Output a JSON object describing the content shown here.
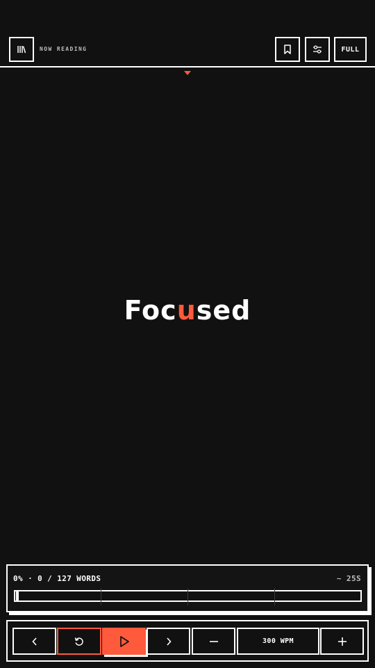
{
  "header": {
    "library_icon": "library-icon",
    "label": "NOW READING",
    "bookmark_icon": "bookmark-icon",
    "settings_icon": "sliders-icon",
    "full_label": "FULL"
  },
  "reader": {
    "word_pre": "Foc",
    "word_focus": "u",
    "word_post": "sed",
    "focus_color": "#ff5a3c"
  },
  "progress": {
    "status": "0% · 0 / 127 WORDS",
    "time_left": "~ 25S",
    "fraction": 0,
    "accent": "#ff5a3c"
  },
  "controls": {
    "prev_icon": "chevron-left-icon",
    "rewind_icon": "restart-icon",
    "play_icon": "play-icon",
    "next_icon": "chevron-right-icon",
    "minus_icon": "minus-icon",
    "wpm_label": "300 WPM",
    "plus_icon": "plus-icon"
  }
}
